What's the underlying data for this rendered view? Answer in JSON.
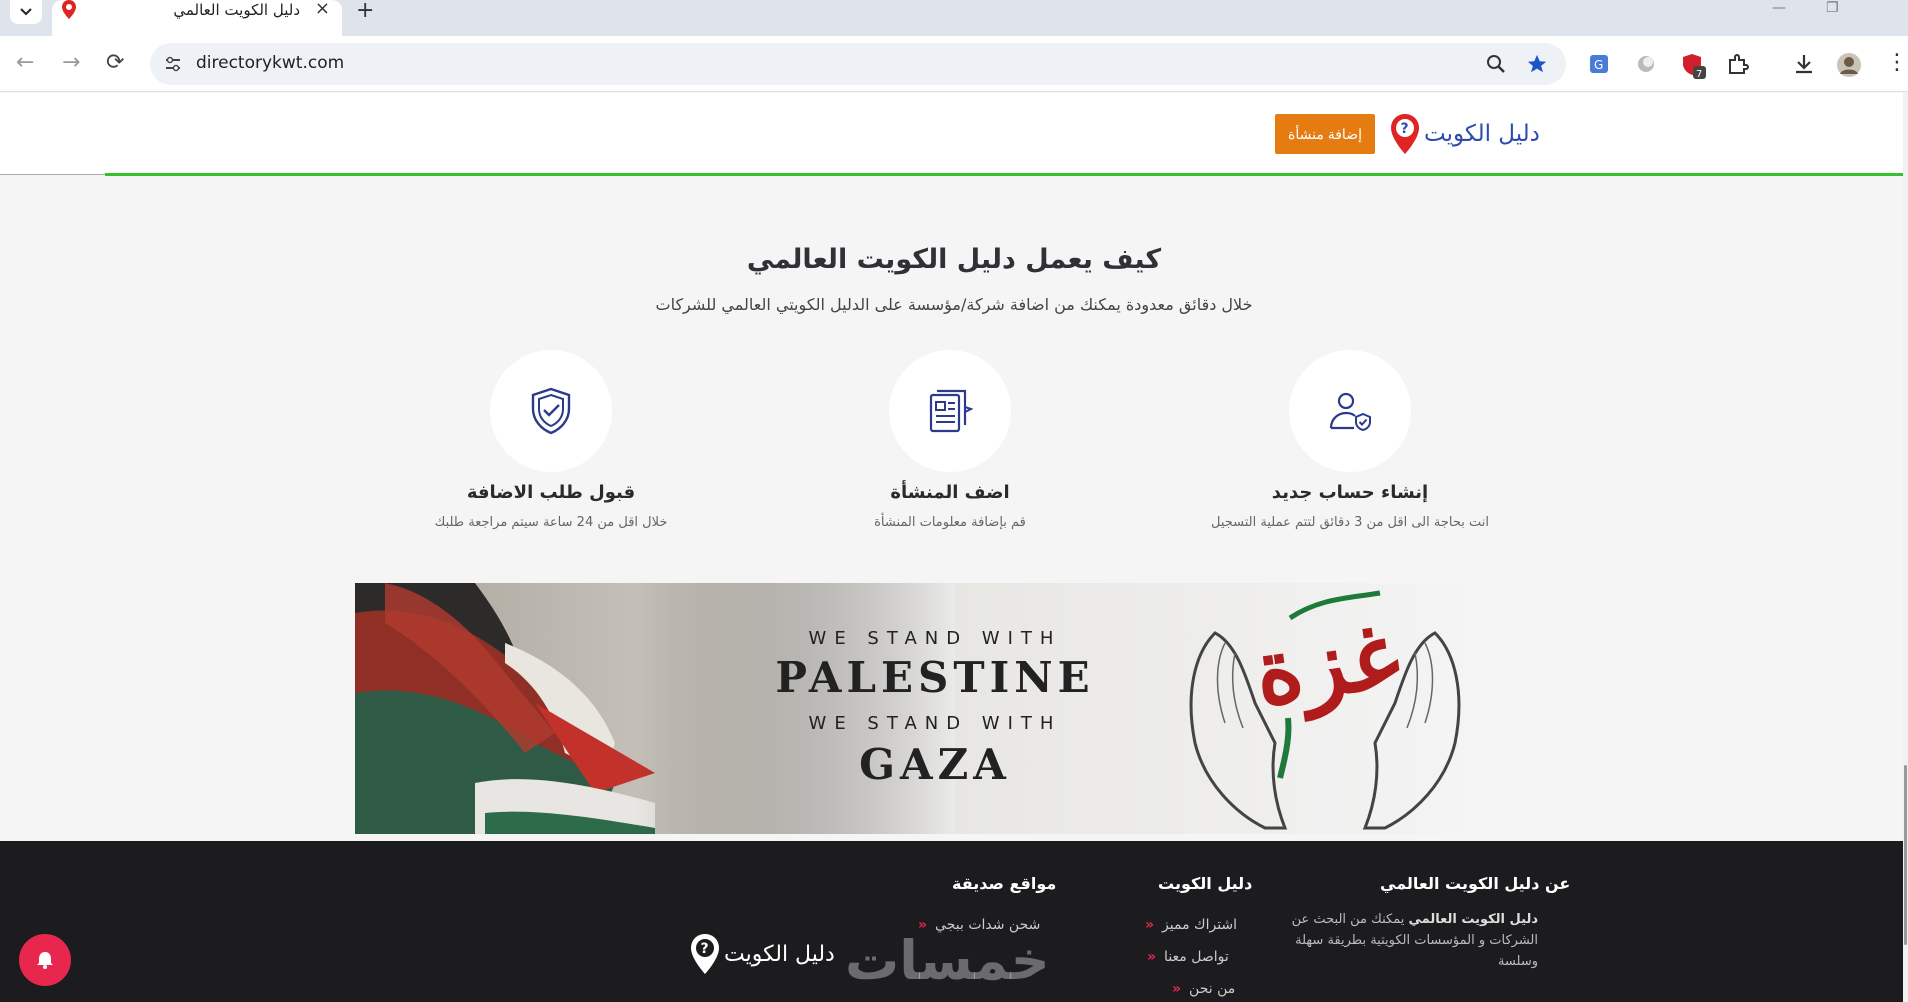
{
  "browser": {
    "tab_title": "دليل الكويت العالمي",
    "url": "directorykwt.com",
    "extension_badge": "7"
  },
  "header": {
    "logo_text": "دليل الكويت",
    "add_button": "إضافة منشأة"
  },
  "how_it_works": {
    "title": "كيف يعمل دليل الكويت العالمي",
    "subtitle": "خلال دقائق معدودة يمكنك من اضافة شركة/مؤسسة على الدليل الكويتي العالمي للشركات",
    "steps": [
      {
        "title": "إنشاء حساب جديد",
        "desc": "انت بحاجة الى اقل من 3 دقائق لتتم عملية التسجيل",
        "icon": "user-check-icon"
      },
      {
        "title": "اضف المنشأة",
        "desc": "قم بإضافة معلومات المنشأة",
        "icon": "document-icon"
      },
      {
        "title": "قبول طلب الاضافة",
        "desc": "خلال اقل من 24 ساعة سيتم مراجعة طلبك",
        "icon": "shield-check-icon"
      }
    ]
  },
  "banner": {
    "line1": "WE STAND WITH",
    "line2": "PALESTINE",
    "line3": "WE STAND WITH",
    "line4": "GAZA",
    "calligraphy": "غزة"
  },
  "footer": {
    "about_title": "عن دليل الكويت العالمي",
    "about_bold": "دليل الكويت العالمي",
    "about_text": " يمكنك من البحث عن الشركات و المؤسسات الكويتية بطريقة سهلة وسلسة",
    "directory_title": "دليل الكويت",
    "directory_links": [
      "اشتراك مميز",
      "تواصل معنا",
      "من نحن"
    ],
    "friends_title": "مواقع صديقة",
    "friends_links": [
      "شحن شدات ببجي"
    ],
    "logo_text": "دليل الكويت",
    "watermark": "خمسات"
  },
  "colors": {
    "accent_orange": "#e57c12",
    "brand_blue": "#2e4bb0",
    "green_line": "#39c02d",
    "footer_bg": "#1c1c1f",
    "pink": "#e8274f"
  }
}
